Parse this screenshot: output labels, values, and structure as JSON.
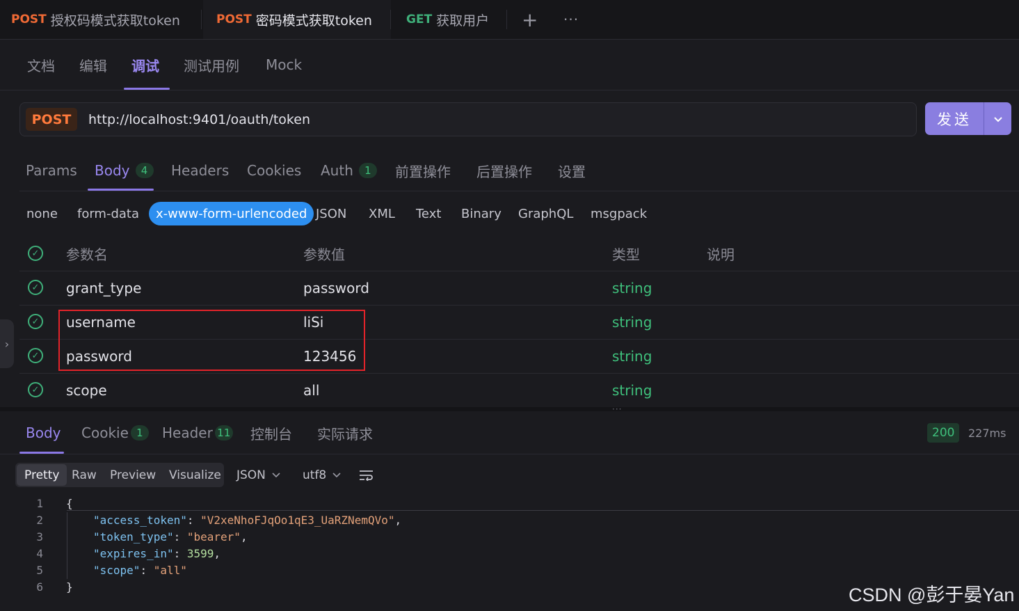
{
  "top_tabs": [
    {
      "method": "POST",
      "label": "授权码模式获取token",
      "method_color": "#f06a35"
    },
    {
      "method": "POST",
      "label": "密码模式获取token",
      "method_color": "#f06a35"
    },
    {
      "method": "GET",
      "label": "获取用户",
      "method_color": "#3fb07a"
    }
  ],
  "top_actions": {
    "add": "+",
    "more": "···"
  },
  "view_tabs": [
    "文档",
    "编辑",
    "调试",
    "测试用例",
    "Mock"
  ],
  "request": {
    "method": "POST",
    "url": "http://localhost:9401/oauth/token",
    "send_label": "发送",
    "send_arrow": "⌄"
  },
  "request_tabs": [
    {
      "label": "Params"
    },
    {
      "label": "Body",
      "badge": "4"
    },
    {
      "label": "Headers"
    },
    {
      "label": "Cookies"
    },
    {
      "label": "Auth",
      "badge": "1"
    },
    {
      "label": "前置操作"
    },
    {
      "label": "后置操作"
    },
    {
      "label": "设置"
    }
  ],
  "body_types": [
    "none",
    "form-data",
    "x-www-form-urlencoded",
    "JSON",
    "XML",
    "Text",
    "Binary",
    "GraphQL",
    "msgpack"
  ],
  "params_table": {
    "headers": [
      "参数名",
      "参数值",
      "类型",
      "说明"
    ],
    "rows": [
      {
        "name": "grant_type",
        "value": "password",
        "type": "string"
      },
      {
        "name": "username",
        "value": "liSi",
        "type": "string"
      },
      {
        "name": "password",
        "value": "123456",
        "type": "string"
      },
      {
        "name": "scope",
        "value": "all",
        "type": "string"
      }
    ]
  },
  "response_tabs": [
    {
      "label": "Body"
    },
    {
      "label": "Cookie",
      "badge": "1"
    },
    {
      "label": "Header",
      "badge": "11"
    },
    {
      "label": "控制台"
    },
    {
      "label": "实际请求"
    }
  ],
  "response_status": {
    "code": "200",
    "time": "227ms"
  },
  "format_tabs": [
    "Pretty",
    "Raw",
    "Preview",
    "Visualize"
  ],
  "format_dropdowns": {
    "lang": "JSON",
    "encoding": "utf8"
  },
  "response_json": {
    "access_token": "V2xeNhoFJqOo1qE3_UaRZNemQVo",
    "token_type": "bearer",
    "expires_in": "3599",
    "scope": "all"
  },
  "line_numbers": [
    "1",
    "2",
    "3",
    "4",
    "5",
    "6"
  ],
  "watermark": "CSDN @彭于晏Yan"
}
